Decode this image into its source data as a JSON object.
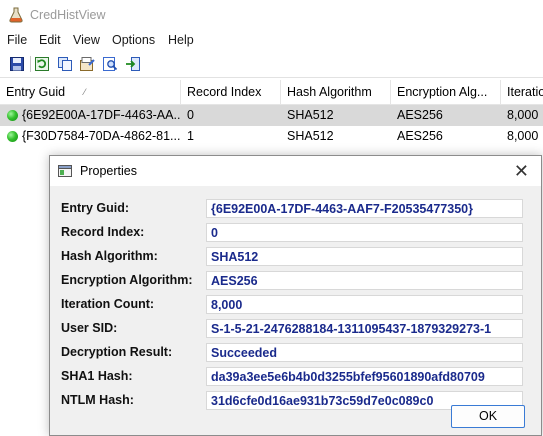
{
  "app": {
    "title": "CredHistView"
  },
  "menu": [
    "File",
    "Edit",
    "View",
    "Options",
    "Help"
  ],
  "toolbar": {
    "icons": [
      "save-icon",
      "refresh-icon",
      "copy-icon",
      "properties-icon",
      "find-icon",
      "exit-icon"
    ]
  },
  "list": {
    "columns": [
      "Entry Guid",
      "Record Index",
      "Hash Algorithm",
      "Encryption Alg...",
      "Iteratio"
    ],
    "rows": [
      {
        "guid": "{6E92E00A-17DF-4463-AA...",
        "index": "0",
        "hash": "SHA512",
        "enc": "AES256",
        "iter": "8,000"
      },
      {
        "guid": "{F30D7584-70DA-4862-81...",
        "index": "1",
        "hash": "SHA512",
        "enc": "AES256",
        "iter": "8,000"
      }
    ]
  },
  "dialog": {
    "title": "Properties",
    "close": "✕",
    "fields": [
      {
        "label": "Entry Guid:",
        "value": "{6E92E00A-17DF-4463-AAF7-F20535477350}"
      },
      {
        "label": "Record Index:",
        "value": "0"
      },
      {
        "label": "Hash Algorithm:",
        "value": "SHA512"
      },
      {
        "label": "Encryption Algorithm:",
        "value": "AES256"
      },
      {
        "label": "Iteration Count:",
        "value": "8,000"
      },
      {
        "label": "User SID:",
        "value": "S-1-5-21-2476288184-1311095437-1879329273-1"
      },
      {
        "label": "Decryption Result:",
        "value": "Succeeded"
      },
      {
        "label": "SHA1 Hash:",
        "value": "da39a3ee5e6b4b0d3255bfef95601890afd80709"
      },
      {
        "label": "NTLM Hash:",
        "value": "31d6cfe0d16ae931b73c59d7e0c089c0"
      }
    ],
    "ok_label": "OK"
  },
  "colors": {
    "value_text": "#1a2a8c",
    "status_green": "#35c12e",
    "focus_blue": "#3a7bd5"
  }
}
